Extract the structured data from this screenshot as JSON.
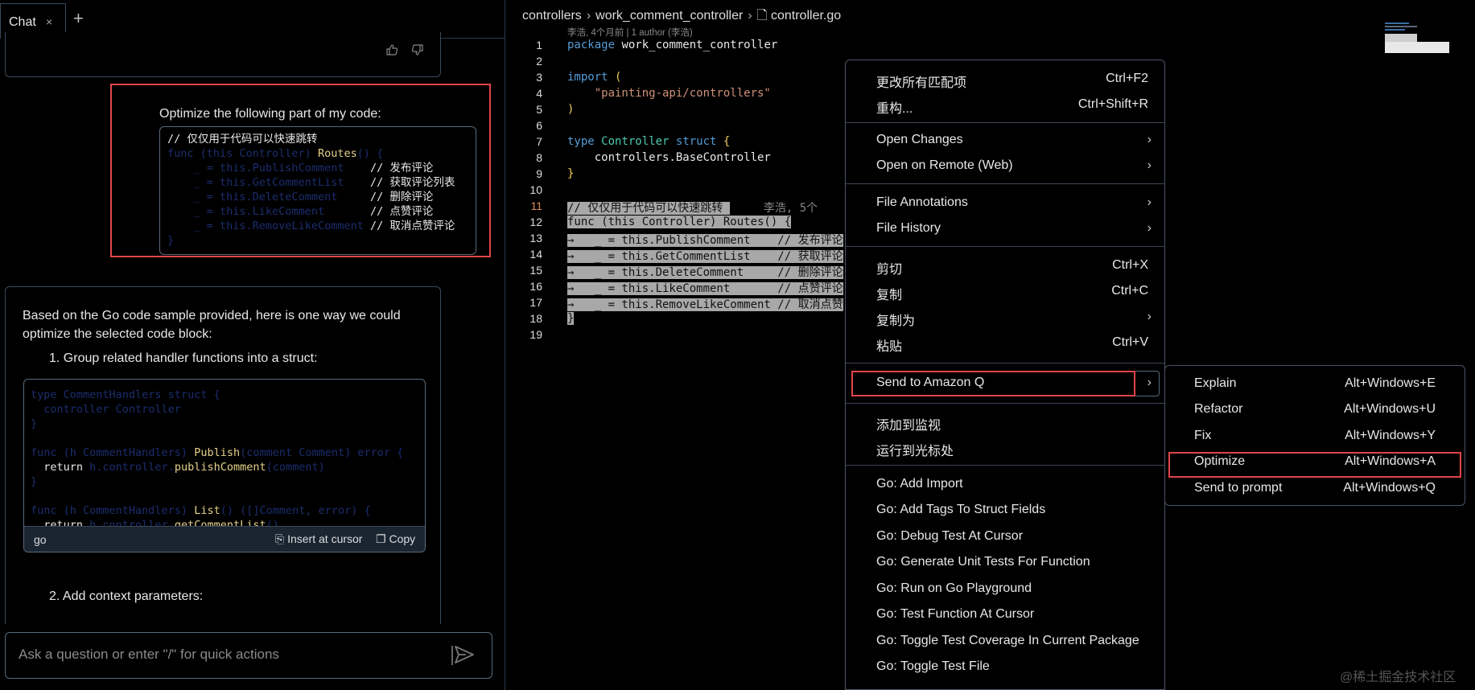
{
  "chat": {
    "tab_label": "Chat",
    "close_glyph": "×",
    "new_tab_glyph": "+",
    "user_prompt": "Optimize the following part of my code:",
    "user_code": [
      {
        "a": "// 仅仅用于代码可以快速跳转",
        "b": ""
      },
      {
        "a": "func (this Controller) ",
        "y": "Routes",
        "c": "() {"
      },
      {
        "p": "    _ = ",
        "d": "this.PublishComment    ",
        "e": "// 发布评论"
      },
      {
        "p": "    _ = ",
        "d": "this.GetCommentList    ",
        "e": "// 获取评论列表"
      },
      {
        "p": "    _ = ",
        "d": "this.DeleteComment     ",
        "e": "// 删除评论"
      },
      {
        "p": "    _ = ",
        "d": "this.LikeComment       ",
        "e": "// 点赞评论"
      },
      {
        "p": "    _ = ",
        "d": "this.RemoveLikeComment ",
        "e": "// 取消点赞评论"
      },
      {
        "a": "}",
        "b": ""
      }
    ],
    "response_intro": "Based on the Go code sample provided, here is one way we could optimize the selected code block:",
    "step1": "1. Group related handler functions into a struct:",
    "response_code_lang": "go",
    "insert_label": "Insert at cursor",
    "copy_label": "Copy",
    "step2": "2. Add context parameters:",
    "input_placeholder": "Ask a question or enter \"/\" for quick actions"
  },
  "editor": {
    "breadcrumb": [
      "controllers",
      "work_comment_controller",
      "controller.go"
    ],
    "blame": "李浩, 4个月前 | 1 author (李浩)",
    "inline_blame": "李浩, 5个",
    "lines": [
      "1",
      "2",
      "3",
      "4",
      "5",
      "6",
      "7",
      "8",
      "9",
      "10",
      "11",
      "12",
      "13",
      "14",
      "15",
      "16",
      "17",
      "18",
      "19"
    ]
  },
  "context_menu": {
    "items": [
      {
        "label": "更改所有匹配项",
        "key": "Ctrl+F2"
      },
      {
        "label": "重构...",
        "key": "Ctrl+Shift+R"
      },
      {
        "label": "Open Changes",
        "key": ""
      },
      {
        "label": "Open on Remote (Web)",
        "key": ""
      },
      {
        "label": "File Annotations",
        "key": ""
      },
      {
        "label": "File History",
        "key": ""
      },
      {
        "label": "剪切",
        "key": "Ctrl+X"
      },
      {
        "label": "复制",
        "key": "Ctrl+C"
      },
      {
        "label": "复制为",
        "key": ""
      },
      {
        "label": "粘贴",
        "key": "Ctrl+V"
      },
      {
        "label": "Send to Amazon Q",
        "key": ""
      },
      {
        "label": "添加到监视",
        "key": ""
      },
      {
        "label": "运行到光标处",
        "key": ""
      },
      {
        "label": "Go: Add Import",
        "key": ""
      },
      {
        "label": "Go: Add Tags To Struct Fields",
        "key": ""
      },
      {
        "label": "Go: Debug Test At Cursor",
        "key": ""
      },
      {
        "label": "Go: Generate Unit Tests For Function",
        "key": ""
      },
      {
        "label": "Go: Run on Go Playground",
        "key": ""
      },
      {
        "label": "Go: Test Function At Cursor",
        "key": ""
      },
      {
        "label": "Go: Toggle Test Coverage In Current Package",
        "key": ""
      },
      {
        "label": "Go: Toggle Test File",
        "key": ""
      }
    ]
  },
  "submenu": {
    "items": [
      {
        "label": "Explain",
        "key": "Alt+Windows+E"
      },
      {
        "label": "Refactor",
        "key": "Alt+Windows+U"
      },
      {
        "label": "Fix",
        "key": "Alt+Windows+Y"
      },
      {
        "label": "Optimize",
        "key": "Alt+Windows+A"
      },
      {
        "label": "Send to prompt",
        "key": "Alt+Windows+Q"
      }
    ]
  },
  "watermark": "@稀土掘金技术社区",
  "colors": {
    "highlight_red": "#e0454a",
    "keyword": "#569cd6",
    "type": "#4ec9b0",
    "string": "#ce9178"
  }
}
